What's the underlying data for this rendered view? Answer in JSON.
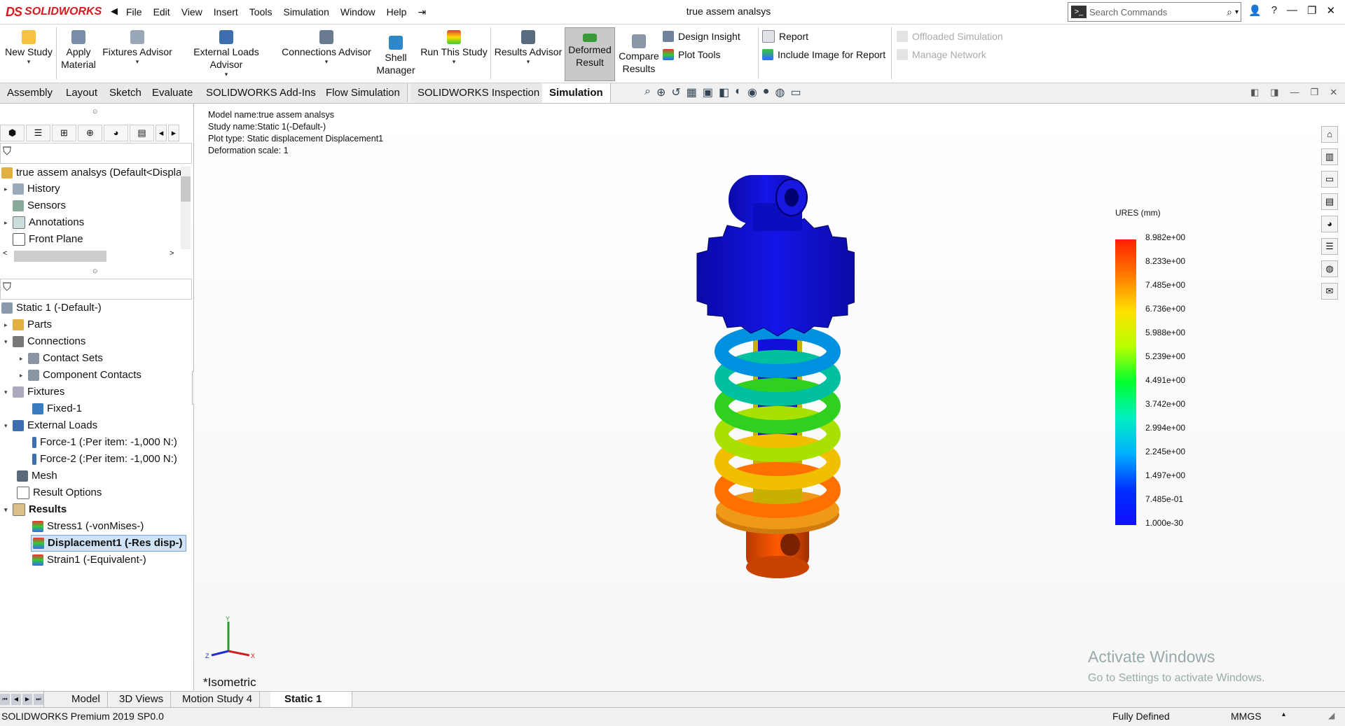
{
  "app": {
    "logo_prefix": "DS",
    "logo_text": "SOLIDWORKS"
  },
  "menu": [
    "File",
    "Edit",
    "View",
    "Insert",
    "Tools",
    "Simulation",
    "Window",
    "Help"
  ],
  "document_title": "true assem analsys",
  "search": {
    "placeholder": "Search Commands"
  },
  "commands": {
    "new_study": "New Study",
    "apply_material": "Apply Material",
    "fixtures_advisor": "Fixtures Advisor",
    "external_loads_advisor": "External Loads Advisor",
    "connections_advisor": "Connections Advisor",
    "shell_manager": "Shell Manager",
    "run_this_study": "Run This Study",
    "results_advisor": "Results Advisor",
    "deformed_result": "Deformed Result",
    "compare_results": "Compare Results",
    "design_insight": "Design Insight",
    "plot_tools": "Plot Tools",
    "report": "Report",
    "include_image": "Include Image for Report",
    "offloaded_simulation": "Offloaded Simulation",
    "manage_network": "Manage Network"
  },
  "tabs": [
    "Assembly",
    "Layout",
    "Sketch",
    "Evaluate",
    "SOLIDWORKS Add-Ins",
    "Flow Simulation",
    "SOLIDWORKS Inspection",
    "Simulation"
  ],
  "active_tab": "Simulation",
  "feature_tree": {
    "root": "true assem analsys  (Default<Displa",
    "items": [
      "History",
      "Sensors",
      "Annotations",
      "Front Plane"
    ]
  },
  "study_tree": {
    "root": "Static 1 (-Default-)",
    "parts": "Parts",
    "connections": "Connections",
    "contact_sets": "Contact Sets",
    "component_contacts": "Component Contacts",
    "fixtures": "Fixtures",
    "fixed1": "Fixed-1",
    "external_loads": "External Loads",
    "force1": "Force-1 (:Per item: -1,000 N:)",
    "force2": "Force-2 (:Per item: -1,000 N:)",
    "mesh": "Mesh",
    "result_options": "Result Options",
    "results": "Results",
    "stress1": "Stress1 (-vonMises-)",
    "displacement1": "Displacement1 (-Res disp-)",
    "strain1": "Strain1 (-Equivalent-)"
  },
  "plot_info": {
    "model": "Model name:true assem analsys",
    "study": "Study name:Static 1(-Default-)",
    "plot_type": "Plot type: Static displacement Displacement1",
    "scale": "Deformation scale: 1"
  },
  "legend": {
    "title": "URES (mm)",
    "values": [
      "8.982e+00",
      "8.233e+00",
      "7.485e+00",
      "6.736e+00",
      "5.988e+00",
      "5.239e+00",
      "4.491e+00",
      "3.742e+00",
      "2.994e+00",
      "2.245e+00",
      "1.497e+00",
      "7.485e-01",
      "1.000e-30"
    ]
  },
  "view_label": "*Isometric",
  "triad": {
    "x": "X",
    "y": "Y",
    "z": "Z"
  },
  "activate": {
    "line1": "Activate Windows",
    "line2": "Go to Settings to activate Windows."
  },
  "bottom_tabs": [
    "Model",
    "3D Views",
    "Motion Study 4",
    "Static 1"
  ],
  "status": {
    "product": "SOLIDWORKS Premium 2019 SP0.0",
    "state": "Fully Defined",
    "units": "MMGS"
  }
}
